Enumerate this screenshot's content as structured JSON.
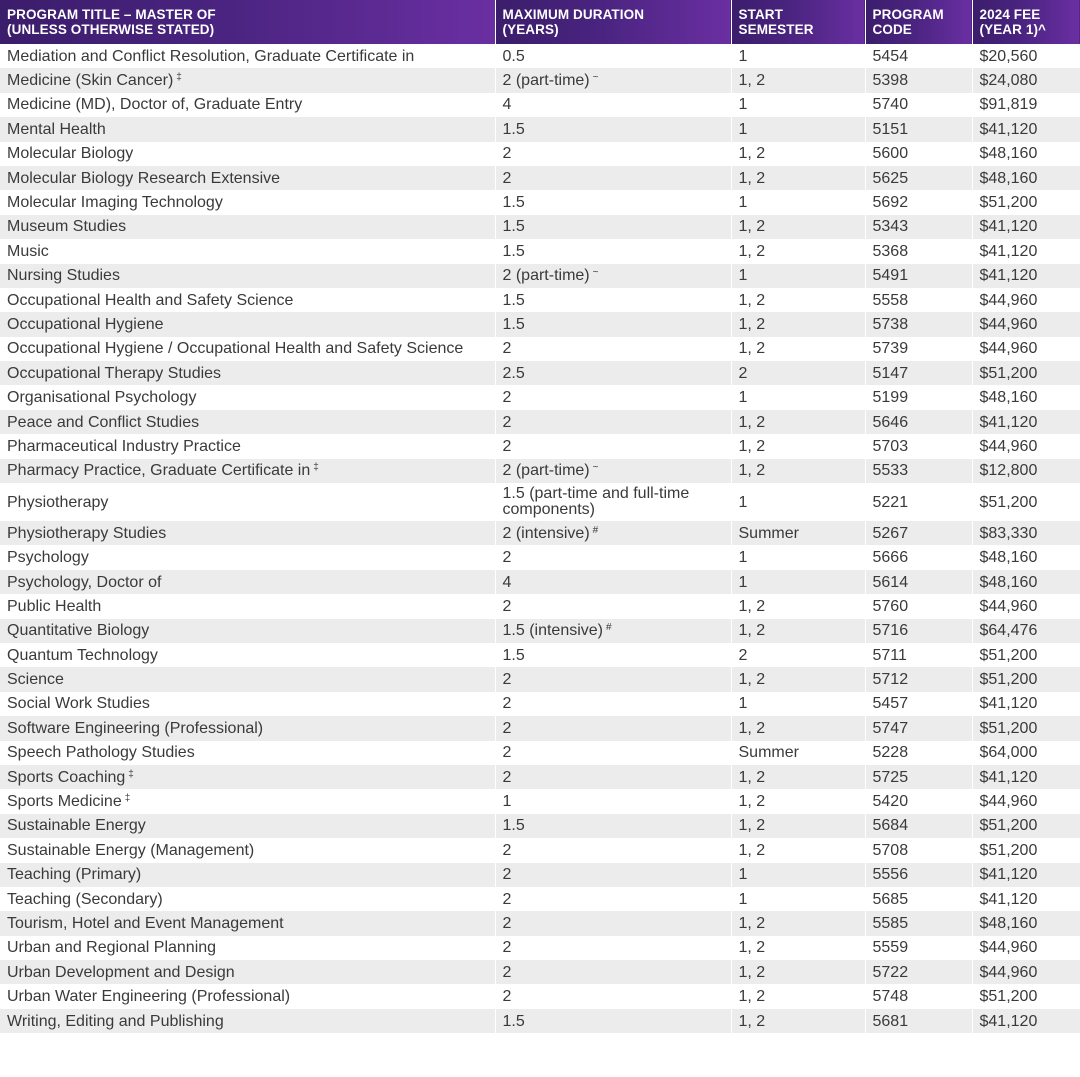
{
  "headers": {
    "title": [
      "PROGRAM TITLE – MASTER OF",
      "(UNLESS OTHERWISE STATED)"
    ],
    "duration": [
      "MAXIMUM DURATION",
      "(YEARS)"
    ],
    "semester": [
      "START",
      "SEMESTER"
    ],
    "code": [
      "PROGRAM",
      "CODE"
    ],
    "fee": [
      "2024 FEE",
      "(YEAR 1)^"
    ]
  },
  "rows": [
    {
      "title": "Mediation and Conflict Resolution, Graduate Certificate in",
      "title_mark": "",
      "duration": "0.5",
      "duration_mark": "",
      "semester": "1",
      "code": "5454",
      "fee": "$20,560"
    },
    {
      "title": "Medicine (Skin Cancer)",
      "title_mark": "‡",
      "duration": "2 (part-time)",
      "duration_mark": "~",
      "semester": "1, 2",
      "code": "5398",
      "fee": "$24,080"
    },
    {
      "title": "Medicine (MD), Doctor of, Graduate Entry",
      "title_mark": "",
      "duration": "4",
      "duration_mark": "",
      "semester": "1",
      "code": "5740",
      "fee": "$91,819"
    },
    {
      "title": "Mental Health",
      "title_mark": "",
      "duration": "1.5",
      "duration_mark": "",
      "semester": "1",
      "code": "5151",
      "fee": "$41,120"
    },
    {
      "title": "Molecular Biology",
      "title_mark": "",
      "duration": "2",
      "duration_mark": "",
      "semester": "1, 2",
      "code": "5600",
      "fee": "$48,160"
    },
    {
      "title": "Molecular Biology Research Extensive",
      "title_mark": "",
      "duration": "2",
      "duration_mark": "",
      "semester": "1, 2",
      "code": "5625",
      "fee": "$48,160"
    },
    {
      "title": "Molecular Imaging Technology",
      "title_mark": "",
      "duration": "1.5",
      "duration_mark": "",
      "semester": "1",
      "code": "5692",
      "fee": "$51,200"
    },
    {
      "title": "Museum Studies",
      "title_mark": "",
      "duration": "1.5",
      "duration_mark": "",
      "semester": "1, 2",
      "code": "5343",
      "fee": "$41,120"
    },
    {
      "title": "Music",
      "title_mark": "",
      "duration": "1.5",
      "duration_mark": "",
      "semester": "1, 2",
      "code": "5368",
      "fee": "$41,120"
    },
    {
      "title": "Nursing Studies",
      "title_mark": "",
      "duration": "2 (part-time)",
      "duration_mark": "~",
      "semester": "1",
      "code": "5491",
      "fee": "$41,120"
    },
    {
      "title": "Occupational Health and Safety Science",
      "title_mark": "",
      "duration": "1.5",
      "duration_mark": "",
      "semester": "1, 2",
      "code": "5558",
      "fee": "$44,960"
    },
    {
      "title": "Occupational Hygiene",
      "title_mark": "",
      "duration": "1.5",
      "duration_mark": "",
      "semester": "1, 2",
      "code": "5738",
      "fee": "$44,960"
    },
    {
      "title": "Occupational Hygiene / Occupational Health and Safety Science",
      "title_mark": "",
      "duration": "2",
      "duration_mark": "",
      "semester": "1, 2",
      "code": "5739",
      "fee": "$44,960"
    },
    {
      "title": "Occupational Therapy Studies",
      "title_mark": "",
      "duration": "2.5",
      "duration_mark": "",
      "semester": "2",
      "code": "5147",
      "fee": "$51,200"
    },
    {
      "title": "Organisational Psychology",
      "title_mark": "",
      "duration": "2",
      "duration_mark": "",
      "semester": "1",
      "code": "5199",
      "fee": "$48,160"
    },
    {
      "title": "Peace and Conflict Studies",
      "title_mark": "",
      "duration": "2",
      "duration_mark": "",
      "semester": "1, 2",
      "code": "5646",
      "fee": "$41,120"
    },
    {
      "title": "Pharmaceutical Industry Practice",
      "title_mark": "",
      "duration": "2",
      "duration_mark": "",
      "semester": "1, 2",
      "code": "5703",
      "fee": "$44,960"
    },
    {
      "title": "Pharmacy Practice, Graduate Certificate in",
      "title_mark": "‡",
      "duration": "2 (part-time)",
      "duration_mark": "~",
      "semester": "1, 2",
      "code": "5533",
      "fee": "$12,800"
    },
    {
      "title": "Physiotherapy",
      "title_mark": "",
      "duration": "1.5 (part-time and full-time components)",
      "duration_mark": "",
      "semester": "1",
      "code": "5221",
      "fee": "$51,200"
    },
    {
      "title": "Physiotherapy Studies",
      "title_mark": "",
      "duration": "2 (intensive)",
      "duration_mark": "#",
      "semester": "Summer",
      "code": "5267",
      "fee": "$83,330"
    },
    {
      "title": "Psychology",
      "title_mark": "",
      "duration": "2",
      "duration_mark": "",
      "semester": "1",
      "code": "5666",
      "fee": "$48,160"
    },
    {
      "title": "Psychology, Doctor of",
      "title_mark": "",
      "duration": "4",
      "duration_mark": "",
      "semester": "1",
      "code": "5614",
      "fee": "$48,160"
    },
    {
      "title": "Public Health",
      "title_mark": "",
      "duration": "2",
      "duration_mark": "",
      "semester": "1, 2",
      "code": "5760",
      "fee": "$44,960"
    },
    {
      "title": "Quantitative Biology",
      "title_mark": "",
      "duration": "1.5 (intensive)",
      "duration_mark": "#",
      "semester": "1, 2",
      "code": "5716",
      "fee": "$64,476"
    },
    {
      "title": "Quantum Technology",
      "title_mark": "",
      "duration": "1.5",
      "duration_mark": "",
      "semester": "2",
      "code": "5711",
      "fee": "$51,200"
    },
    {
      "title": "Science",
      "title_mark": "",
      "duration": "2",
      "duration_mark": "",
      "semester": "1, 2",
      "code": "5712",
      "fee": "$51,200"
    },
    {
      "title": "Social Work Studies",
      "title_mark": "",
      "duration": "2",
      "duration_mark": "",
      "semester": "1",
      "code": "5457",
      "fee": "$41,120"
    },
    {
      "title": "Software Engineering (Professional)",
      "title_mark": "",
      "duration": "2",
      "duration_mark": "",
      "semester": "1, 2",
      "code": "5747",
      "fee": "$51,200"
    },
    {
      "title": "Speech Pathology Studies",
      "title_mark": "",
      "duration": "2",
      "duration_mark": "",
      "semester": "Summer",
      "code": "5228",
      "fee": "$64,000"
    },
    {
      "title": "Sports Coaching",
      "title_mark": "‡",
      "duration": "2",
      "duration_mark": "",
      "semester": "1, 2",
      "code": "5725",
      "fee": "$41,120"
    },
    {
      "title": "Sports Medicine",
      "title_mark": "‡",
      "duration": "1",
      "duration_mark": "",
      "semester": "1, 2",
      "code": "5420",
      "fee": "$44,960"
    },
    {
      "title": "Sustainable Energy",
      "title_mark": "",
      "duration": "1.5",
      "duration_mark": "",
      "semester": "1, 2",
      "code": "5684",
      "fee": "$51,200"
    },
    {
      "title": "Sustainable Energy (Management)",
      "title_mark": "",
      "duration": "2",
      "duration_mark": "",
      "semester": "1, 2",
      "code": "5708",
      "fee": "$51,200"
    },
    {
      "title": "Teaching (Primary)",
      "title_mark": "",
      "duration": "2",
      "duration_mark": "",
      "semester": "1",
      "code": "5556",
      "fee": "$41,120"
    },
    {
      "title": "Teaching (Secondary)",
      "title_mark": "",
      "duration": "2",
      "duration_mark": "",
      "semester": "1",
      "code": "5685",
      "fee": "$41,120"
    },
    {
      "title": "Tourism, Hotel and Event Management",
      "title_mark": "",
      "duration": "2",
      "duration_mark": "",
      "semester": "1, 2",
      "code": "5585",
      "fee": "$48,160"
    },
    {
      "title": "Urban and Regional Planning",
      "title_mark": "",
      "duration": "2",
      "duration_mark": "",
      "semester": "1, 2",
      "code": "5559",
      "fee": "$44,960"
    },
    {
      "title": "Urban Development and Design",
      "title_mark": "",
      "duration": "2",
      "duration_mark": "",
      "semester": "1, 2",
      "code": "5722",
      "fee": "$44,960"
    },
    {
      "title": "Urban Water Engineering (Professional)",
      "title_mark": "",
      "duration": "2",
      "duration_mark": "",
      "semester": "1, 2",
      "code": "5748",
      "fee": "$51,200"
    },
    {
      "title": "Writing, Editing and Publishing",
      "title_mark": "",
      "duration": "1.5",
      "duration_mark": "",
      "semester": "1, 2",
      "code": "5681",
      "fee": "$41,120"
    }
  ]
}
